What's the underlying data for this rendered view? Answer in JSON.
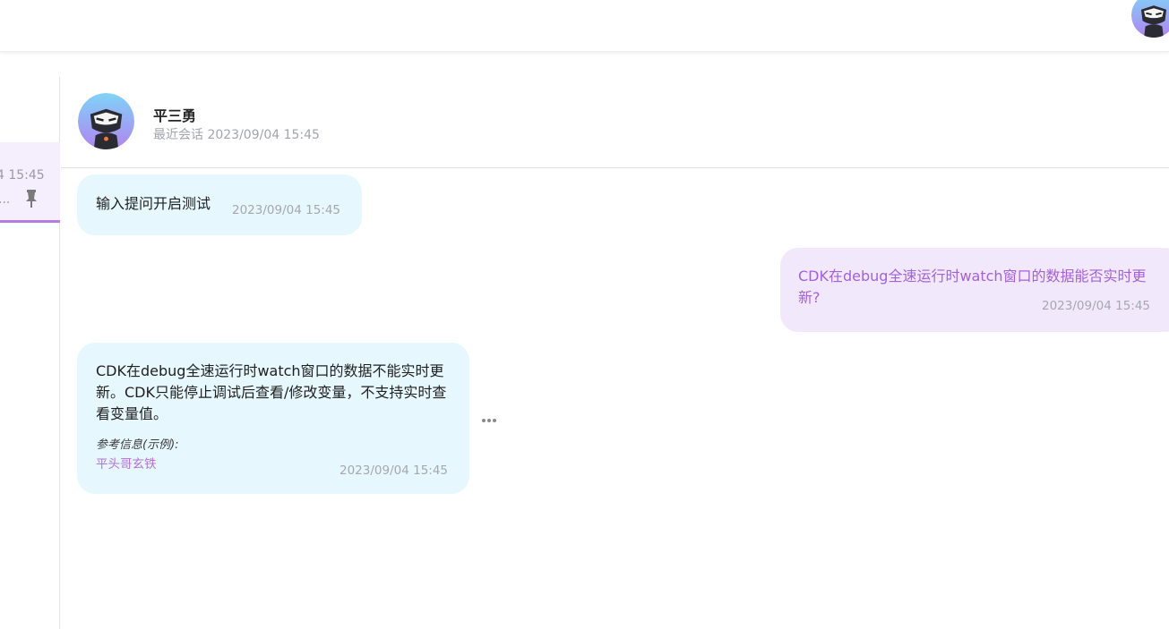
{
  "sidebar": {
    "active_session": {
      "time": "4 15:45",
      "preview": "..."
    }
  },
  "header": {
    "name": "平三勇",
    "last_chat_label": "最近会话",
    "last_chat_time": "2023/09/04 15:45"
  },
  "messages": [
    {
      "role": "bot",
      "text": "输入提问开启测试",
      "time": "2023/09/04 15:45"
    },
    {
      "role": "user",
      "text": "CDK在debug全速运行时watch窗口的数据能否实时更新?",
      "time": "2023/09/04 15:45"
    },
    {
      "role": "bot",
      "text": "CDK在debug全速运行时watch窗口的数据不能实时更新。CDK只能停止调试后查看/修改变量，不支持实时查看变量值。",
      "reference_label": "参考信息(示例):",
      "reference_link": "平头哥玄铁",
      "time": "2023/09/04 15:45"
    }
  ],
  "colors": {
    "accent": "#b47be0",
    "bot_bubble": "#e6f7fd",
    "user_bubble": "#f2e8fc",
    "user_text": "#a461d8"
  },
  "icons": [
    "avatar-mascot-icon",
    "pin-icon",
    "more-icon"
  ]
}
